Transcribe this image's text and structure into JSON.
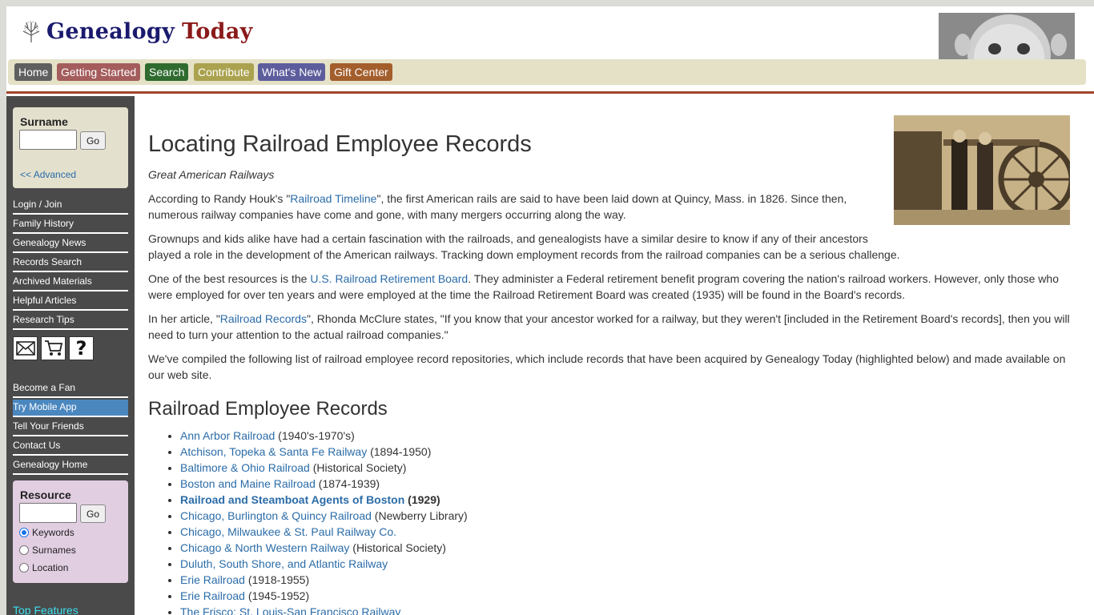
{
  "header": {
    "logo_word1": "Genealogy",
    "logo_word2": "Today",
    "nav": [
      {
        "label": "Home",
        "color": "#5a5a5a"
      },
      {
        "label": "Getting Started",
        "color": "#a65a5a"
      },
      {
        "label": "Search",
        "color": "#2f6b2f"
      },
      {
        "label": "Contribute",
        "color": "#a8a04a"
      },
      {
        "label": "What's New",
        "color": "#5a5a9a"
      },
      {
        "label": "Gift Center",
        "color": "#9a5a2a"
      }
    ]
  },
  "sidebar": {
    "surname_label": "Surname",
    "go_label": "Go",
    "advanced_label": "<< Advanced",
    "links": [
      "Login / Join",
      "Family History",
      "Genealogy News",
      "Records Search",
      "Archived Materials",
      "Helpful Articles",
      "Research Tips"
    ],
    "links2": [
      "Become a Fan",
      "Try Mobile App",
      "Tell Your Friends",
      "Contact Us",
      "Genealogy Home"
    ],
    "resource_label": "Resource",
    "radios": [
      "Keywords",
      "Surnames",
      "Location"
    ],
    "top_features": "Top Features"
  },
  "main": {
    "title": "Locating Railroad Employee Records",
    "subtitle": "Great American Railways",
    "p1_pre": "According to Randy Houk's \"",
    "p1_link": "Railroad Timeline",
    "p1_mid": "\", the first American rails are said to have been laid down at Quincy, Mass. in 1826. Since then,",
    "p1_post": "numerous railway companies have come and gone, with many mergers occurring along the way.",
    "p2_l1": "Grownups and kids alike have had a certain fascination with the railroads, and genealogists have a similar desire to know if any of their ancestors",
    "p2_l2": "played a role in the development of the American railways. Tracking down employment records from the railroad companies can be a serious challenge.",
    "p3_pre": "One of the best resources is the ",
    "p3_link": "U.S. Railroad Retirement Board",
    "p3_mid": ". They administer a Federal retirement benefit program covering the nation's railroad workers. However, only those who",
    "p3_post": "were employed for over ten years and were employed at the time the Railroad Retirement Board was created (1935) will be found in the Board's records.",
    "p4_pre": "In her article, \"",
    "p4_link": "Railroad Records",
    "p4_mid": "\", Rhonda McClure states, \"If you know that your ancestor worked for a railway, but they weren't [included in the Retirement Board's records], then you will",
    "p4_post": "need to turn your attention to the actual railroad companies.\"",
    "p5_l1": "We've compiled the following list of railroad employee record repositories, which include records that have been acquired by Genealogy Today (highlighted below) and made available on",
    "p5_l2": "our web site.",
    "section_title": "Railroad Employee Records",
    "records": [
      {
        "link": "Ann Arbor Railroad",
        "note": " (1940's-1970's)",
        "bold": false
      },
      {
        "link": "Atchison, Topeka & Santa Fe Railway",
        "note": " (1894-1950)",
        "bold": false
      },
      {
        "link": "Baltimore & Ohio Railroad",
        "note": " (Historical Society)",
        "bold": false
      },
      {
        "link": "Boston and Maine Railroad",
        "note": " (1874-1939)",
        "bold": false
      },
      {
        "link": "Railroad and Steamboat Agents of Boston",
        "note": " (1929)",
        "bold": true
      },
      {
        "link": "Chicago, Burlington & Quincy Railroad",
        "note": " (Newberry Library)",
        "bold": false
      },
      {
        "link": "Chicago, Milwaukee & St. Paul Railway Co.",
        "note": "",
        "bold": false
      },
      {
        "link": "Chicago & North Western Railway",
        "note": " (Historical Society)",
        "bold": false
      },
      {
        "link": "Duluth, South Shore, and Atlantic Railway",
        "note": "",
        "bold": false
      },
      {
        "link": "Erie Railroad",
        "note": " (1918-1955)",
        "bold": false
      },
      {
        "link": "Erie Railroad",
        "note": " (1945-1952)",
        "bold": false
      },
      {
        "link": "The Frisco: St. Louis-San Francisco Railway",
        "note": "",
        "bold": false
      }
    ]
  }
}
